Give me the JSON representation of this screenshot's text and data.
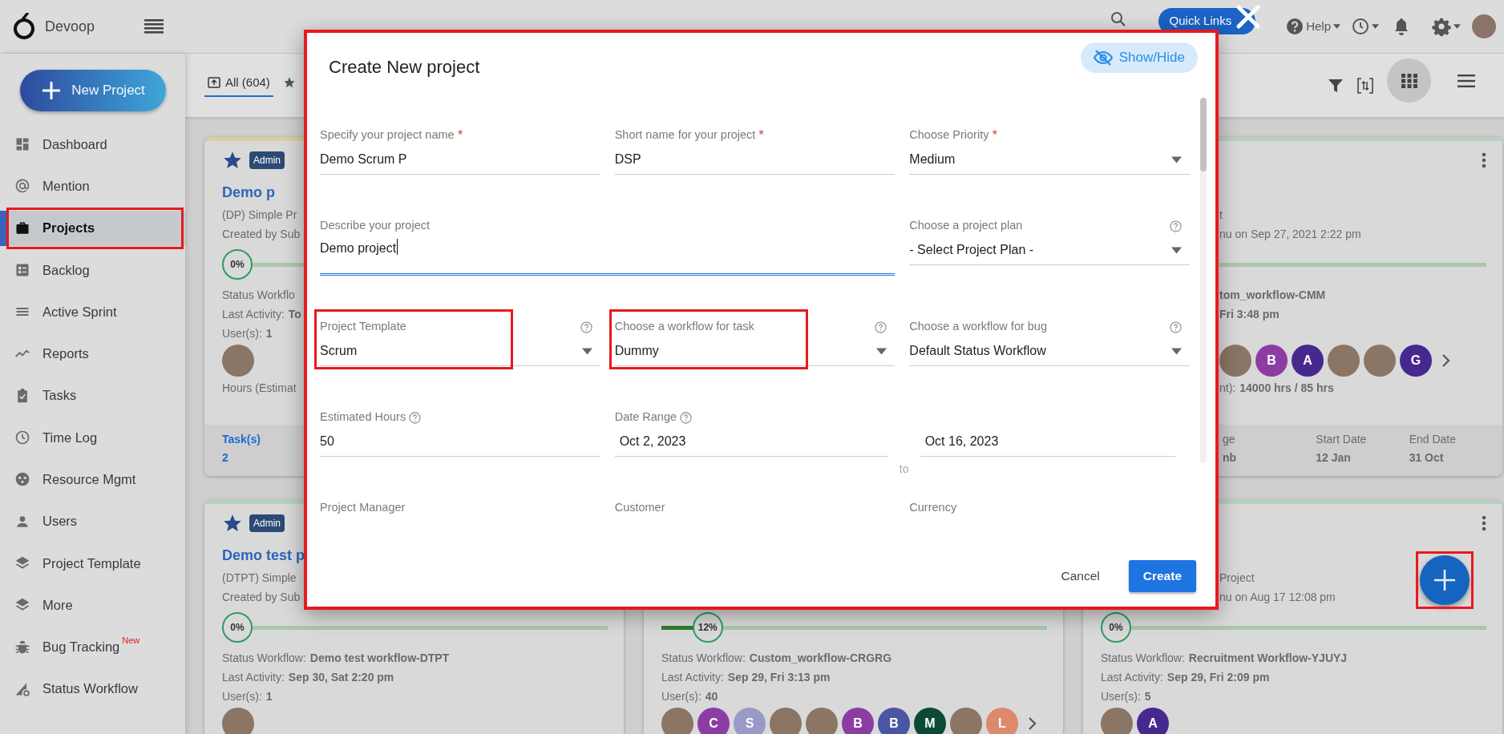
{
  "app": {
    "name": "Devoop"
  },
  "topbar": {
    "quick_links": "Quick Links",
    "help": "Help"
  },
  "sidebar": {
    "new_project": "New Project",
    "items": [
      {
        "label": "Dashboard",
        "selected": false,
        "highlighted": false
      },
      {
        "label": "Mention",
        "selected": false,
        "highlighted": false
      },
      {
        "label": "Projects",
        "selected": true,
        "highlighted": true
      },
      {
        "label": "Backlog",
        "selected": false,
        "highlighted": false
      },
      {
        "label": "Active Sprint",
        "selected": false,
        "highlighted": false
      },
      {
        "label": "Reports",
        "selected": false,
        "highlighted": false
      },
      {
        "label": "Tasks",
        "selected": false,
        "highlighted": false
      },
      {
        "label": "Time Log",
        "selected": false,
        "highlighted": false
      },
      {
        "label": "Resource Mgmt",
        "selected": false,
        "highlighted": false
      },
      {
        "label": "Users",
        "selected": false,
        "highlighted": false
      },
      {
        "label": "Project Template",
        "selected": false,
        "highlighted": false
      },
      {
        "label": "More",
        "selected": false,
        "highlighted": false
      },
      {
        "label": "Bug Tracking",
        "badge": "New",
        "selected": false,
        "highlighted": false
      },
      {
        "label": "Status Workflow",
        "selected": false,
        "highlighted": false
      }
    ]
  },
  "tabs": [
    {
      "label": "All (604)",
      "selected": true
    },
    {
      "selected": false
    }
  ],
  "views": [
    {
      "kind": "grid",
      "selected": true
    },
    {
      "kind": "list",
      "selected": false
    }
  ],
  "cards": [
    {
      "color": "#d6cf9e",
      "starred": true,
      "role": "Admin",
      "title": "Demo p",
      "subtitle": "(DP) Simple Pr",
      "created": "Created by Sub",
      "progress": {
        "label": "0%",
        "level": 0
      },
      "status_label": "Status Workflo",
      "last_label": "Last Activity:",
      "last_value": "To",
      "users_label": "User(s):",
      "users_value": "1",
      "avatars": [
        {
          "kind": "photo"
        }
      ],
      "hours_label": "Hours (Estimat",
      "footer": [
        {
          "kind": "link",
          "label": "Task(s)",
          "value": "2"
        }
      ]
    },
    {
      "color": "#b7d2bf",
      "menu": true,
      "subtitle": "t",
      "created": "nu on Sep 27, 2021 2:22 pm",
      "progress": {
        "level": 0
      },
      "status_value": "tom_workflow-CMM",
      "last_value": "Fri 3:48 pm",
      "avatars": [
        {
          "kind": "photo"
        },
        {
          "kind": "letter",
          "letter": "B",
          "color": "#8c3da3"
        },
        {
          "kind": "letter",
          "letter": "A",
          "color": "#47288f"
        },
        {
          "kind": "photo"
        },
        {
          "kind": "photo"
        },
        {
          "kind": "letter",
          "letter": "G",
          "color": "#47288f"
        }
      ],
      "more": true,
      "hours_label": "nt):",
      "hours_value": "14000 hrs / 85 hrs",
      "footer": [
        {
          "kind": "plain",
          "label": "ge",
          "value": "nb"
        },
        {
          "kind": "plain",
          "label": "Start Date",
          "value": "12 Jan"
        },
        {
          "kind": "plain",
          "label": "End Date",
          "value": "31 Oct"
        }
      ]
    },
    {
      "color": "#b7d2bf",
      "starred": true,
      "role": "Admin",
      "title": "Demo test p",
      "subtitle": "(DTPT) Simple",
      "created": "Created by Sub",
      "progress": {
        "label": "0%",
        "level": 0
      },
      "status_label": "Status Workflow:",
      "status_value": "Demo test workflow-DTPT",
      "last_label": "Last Activity:",
      "last_value": "Sep 30, Sat 2:20 pm",
      "users_label": "User(s):",
      "users_value": "1",
      "avatars": [
        {
          "kind": "photo"
        }
      ]
    },
    {
      "progress": {
        "label": "12%",
        "level": 0.12
      },
      "status_label": "Status Workflow:",
      "status_value": "Custom_workflow-CRGRG",
      "last_label": "Last Activity:",
      "last_value": "Sep 29, Fri 3:13 pm",
      "users_label": "User(s):",
      "users_value": "40",
      "avatars": [
        {
          "kind": "photo"
        },
        {
          "kind": "letter",
          "letter": "C",
          "color": "#8c3da3"
        },
        {
          "kind": "letter",
          "letter": "S",
          "color": "#9a9ac6"
        },
        {
          "kind": "photo"
        },
        {
          "kind": "photo"
        },
        {
          "kind": "letter",
          "letter": "B",
          "color": "#8c3da3"
        },
        {
          "kind": "letter",
          "letter": "B",
          "color": "#4a56a3"
        },
        {
          "kind": "letter",
          "letter": "M",
          "color": "#0c4a33"
        },
        {
          "kind": "photo"
        },
        {
          "kind": "letter",
          "letter": "L",
          "color": "#dc8a6c"
        }
      ],
      "more": true
    },
    {
      "color": "#b7d2bf",
      "menu": true,
      "subtitle": "Project",
      "created": "nu on Aug 17 12:08 pm",
      "progress": {
        "label": "0%",
        "level": 0
      },
      "status_label": "Status Workflow:",
      "status_value": "Recruitment Workflow-YJUYJ",
      "last_label": "Last Activity:",
      "last_value": "Sep 29, Fri 2:09 pm",
      "users_label": "User(s):",
      "users_value": "5",
      "avatars": [
        {
          "kind": "photo"
        },
        {
          "kind": "letter",
          "letter": "A",
          "color": "#47288f"
        }
      ]
    }
  ],
  "modal": {
    "title": "Create New project",
    "show_hide": "Show/Hide",
    "highlighted": true,
    "required_mark": "*",
    "cancel": "Cancel",
    "create": "Create",
    "fields": [
      {
        "kind": "text",
        "label": "Specify your project name",
        "required": true,
        "help": false,
        "highlighted": false,
        "focused": false,
        "value": "Demo Scrum P"
      },
      {
        "kind": "text",
        "label": "Short name for your project",
        "required": true,
        "help": false,
        "highlighted": false,
        "focused": false,
        "value": "DSP"
      },
      {
        "kind": "select",
        "label": "Choose Priority",
        "required": true,
        "help": false,
        "highlighted": false,
        "focused": false,
        "value": "Medium"
      },
      {
        "kind": "textarea",
        "label": "Describe your project",
        "required": false,
        "help": false,
        "highlighted": false,
        "focused": true,
        "value": "Demo project"
      },
      {
        "kind": "select",
        "label": "Choose a project plan",
        "required": false,
        "help": true,
        "highlighted": false,
        "focused": false,
        "value": "- Select Project Plan -"
      },
      {
        "kind": "select",
        "label": "Project Template",
        "required": false,
        "help": true,
        "highlighted": true,
        "focused": false,
        "value": "Scrum"
      },
      {
        "kind": "select",
        "label": "Choose a workflow for task",
        "required": false,
        "help": true,
        "highlighted": true,
        "focused": false,
        "value": "Dummy"
      },
      {
        "kind": "select",
        "label": "Choose a workflow for bug",
        "required": false,
        "help": true,
        "highlighted": false,
        "focused": false,
        "value": "Default Status Workflow"
      },
      {
        "kind": "text",
        "label": "Estimated Hours",
        "required": false,
        "help": true,
        "highlighted": false,
        "focused": false,
        "value": "50"
      },
      {
        "kind": "daterange",
        "label": "Date Range",
        "required": false,
        "help": true,
        "highlighted": false,
        "focused": false,
        "value": "Oct 2, 2023",
        "separator": "to",
        "end_value": "Oct 16, 2023"
      },
      {
        "kind": "label",
        "label": "Project Manager"
      },
      {
        "kind": "label",
        "label": "Customer"
      },
      {
        "kind": "label",
        "label": "Currency"
      }
    ]
  },
  "fab": {
    "highlighted": true
  }
}
